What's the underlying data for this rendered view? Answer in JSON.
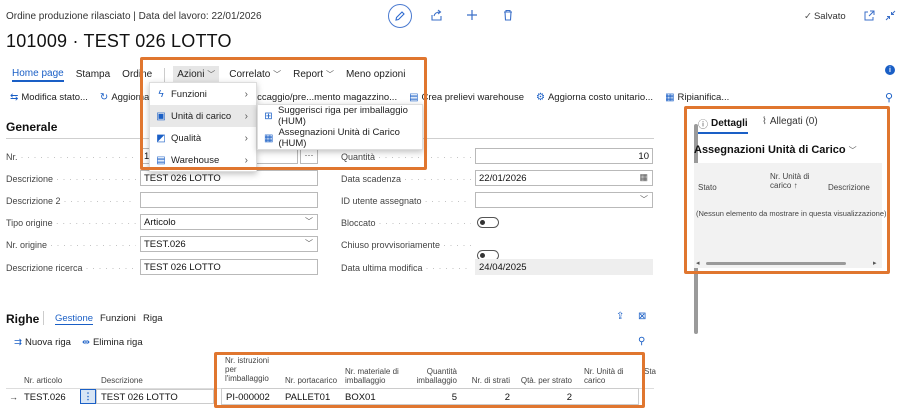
{
  "header": {
    "page_caption": "Ordine produzione rilasciato | Data del lavoro: 22/01/2026",
    "record_title": "101009 · TEST 026 LOTTO",
    "saved_label": "Salvato"
  },
  "menu": {
    "items": [
      "Home page",
      "Stampa",
      "Ordine",
      "Azioni",
      "Correlato",
      "Report",
      "Meno opzioni"
    ]
  },
  "actions": {
    "items": [
      "Modifica stato...",
      "Aggiorna o",
      "ea stoccaggio/pre...mento magazzino...",
      "Crea prelievi warehouse",
      "Aggiorna costo unitario...",
      "Ripianifica..."
    ]
  },
  "azioni_menu": {
    "items": [
      {
        "label": "Funzioni",
        "icon": "lightning-icon"
      },
      {
        "label": "Unità di carico",
        "icon": "pallet-icon"
      },
      {
        "label": "Qualità",
        "icon": "quality-icon"
      },
      {
        "label": "Warehouse",
        "icon": "warehouse-icon"
      }
    ],
    "submenu": [
      "Suggerisci riga per imballaggio (HUM)",
      "Assegnazioni Unità di Carico (HUM)"
    ]
  },
  "generale": {
    "title": "Generale",
    "left": [
      {
        "label": "Nr.",
        "value": "10"
      },
      {
        "label": "Descrizione",
        "value": "TEST 026 LOTTO"
      },
      {
        "label": "Descrizione 2",
        "value": ""
      },
      {
        "label": "Tipo origine",
        "value": "Articolo"
      },
      {
        "label": "Nr. origine",
        "value": "TEST.026"
      },
      {
        "label": "Descrizione ricerca",
        "value": "TEST 026 LOTTO"
      }
    ],
    "right": [
      {
        "label": "Quantità",
        "value": "10"
      },
      {
        "label": "Data scadenza",
        "value": "22/01/2026"
      },
      {
        "label": "ID utente assegnato",
        "value": ""
      },
      {
        "label": "Bloccato",
        "value": ""
      },
      {
        "label": "Chiuso provvisoriamente",
        "value": ""
      },
      {
        "label": "Data ultima modifica",
        "value": "24/04/2025"
      }
    ]
  },
  "righe": {
    "title": "Righe",
    "tabs": [
      "Gestione",
      "Funzioni",
      "Riga"
    ],
    "actions": [
      "Nuova riga",
      "Elimina riga"
    ],
    "columns_left": [
      "Nr. articolo",
      "Descrizione"
    ],
    "row_left": [
      "TEST.026",
      "TEST 026 LOTTO"
    ],
    "columns_hl": [
      "Nr. istruzioni per l'imballaggio",
      "Nr. portacarico",
      "Nr. materiale di imballaggio",
      "Quantità imballaggio",
      "Nr. di strati",
      "Qtà. per strato",
      "Nr. Unità di carico"
    ],
    "row_hl": [
      "PI-000002",
      "PALLET01",
      "BOX01",
      "5",
      "2",
      "2",
      ""
    ],
    "extra_col": "Sta"
  },
  "factbox": {
    "tabs": [
      "Dettagli",
      "Allegati (0)"
    ],
    "title": "Assegnazioni Unità di Carico",
    "columns": [
      "Stato",
      "Nr. Unità di carico",
      "Descrizione"
    ],
    "empty_text": "(Nessun elemento da mostrare in questa visualizzazione)"
  },
  "colors": {
    "accent": "#1a5fc6",
    "highlight": "#e0762f"
  }
}
